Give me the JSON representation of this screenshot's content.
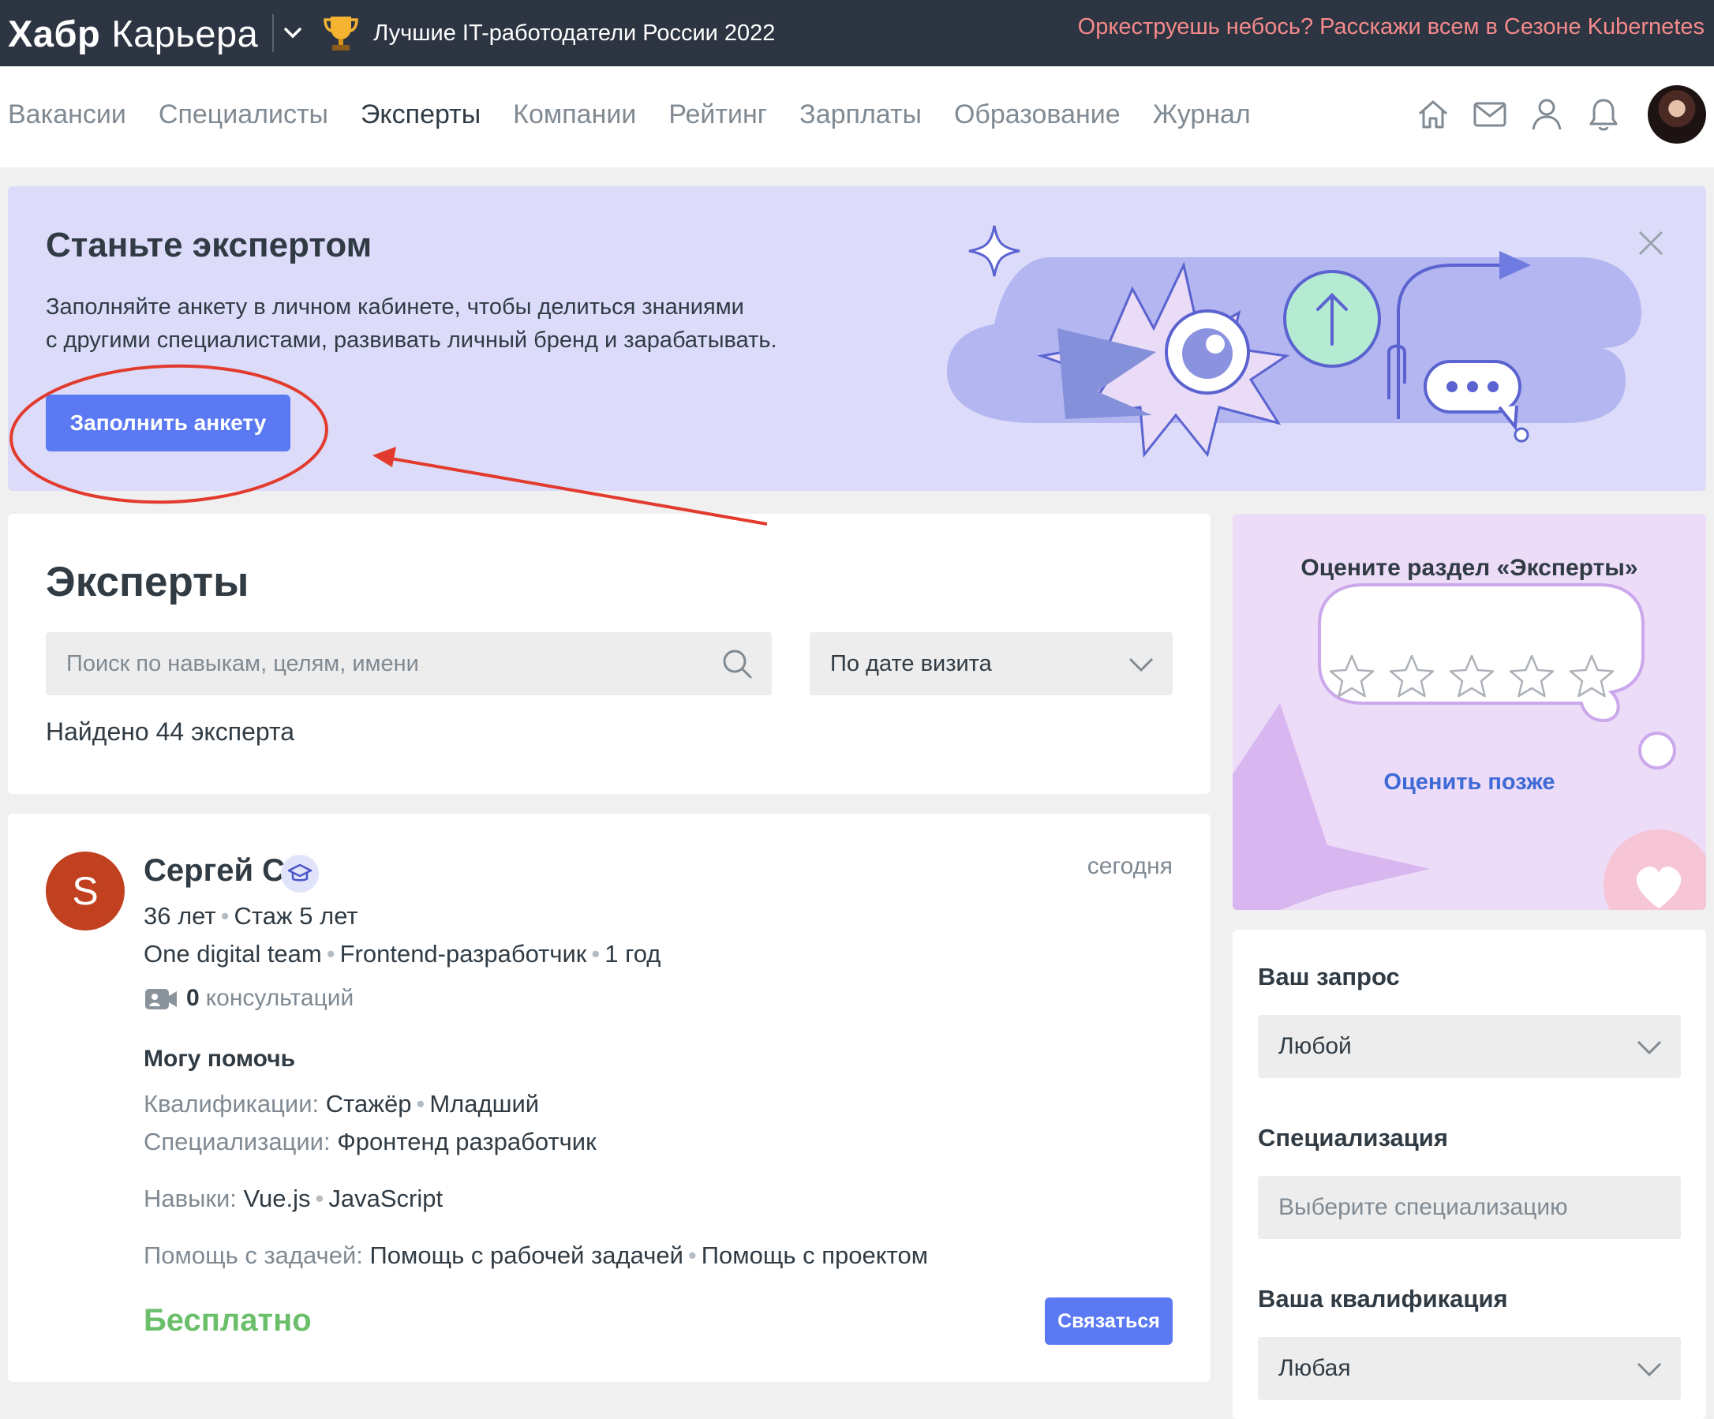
{
  "topbar": {
    "logo_bold": "Хабр",
    "logo_light": "Карьера",
    "promo_left": "Лучшие IT-работодатели России 2022",
    "promo_right": "Оркеструешь небось? Расскажи всем в Сезоне Kubernetes"
  },
  "nav": {
    "items": [
      "Вакансии",
      "Специалисты",
      "Эксперты",
      "Компании",
      "Рейтинг",
      "Зарплаты",
      "Образование",
      "Журнал"
    ],
    "active": "Эксперты",
    "icons": [
      "home-icon",
      "mail-icon",
      "user-icon",
      "bell-icon"
    ]
  },
  "banner": {
    "title": "Станьте экспертом",
    "text_line1": "Заполняйте анкету в личном кабинете, чтобы делиться знаниями",
    "text_line2": "с другими специалистами, развивать личный бренд и зарабатывать.",
    "button": "Заполнить анкету"
  },
  "experts": {
    "title": "Эксперты",
    "search_placeholder": "Поиск по навыкам, целям, имени",
    "sort_value": "По дате визита",
    "found": "Найдено 44 эксперта"
  },
  "expert": {
    "initial": "S",
    "name": "Сергей С",
    "date": "сегодня",
    "age": "36 лет",
    "experience": "Стаж 5 лет",
    "company": "One digital team",
    "role": "Frontend-разработчик",
    "duration": "1 год",
    "consult_count": "0",
    "consult_label": "консультаций",
    "can_help": "Могу помочь",
    "qual_label": "Квалификации:",
    "qual_1": "Стажёр",
    "qual_2": "Младший",
    "spec_label": "Специализации:",
    "spec_value": "Фронтенд разработчик",
    "skills_label": "Навыки:",
    "skill_1": "Vue.js",
    "skill_2": "JavaScript",
    "help_label": "Помощь с задачей:",
    "help_1": "Помощь с рабочей задачей",
    "help_2": "Помощь с проектом",
    "price": "Бесплатно",
    "contact": "Связаться"
  },
  "rating": {
    "title": "Оцените раздел «Эксперты»",
    "stars": 5,
    "later": "Оценить позже"
  },
  "filters": {
    "request_label": "Ваш запрос",
    "request_value": "Любой",
    "spec_label": "Специализация",
    "spec_placeholder": "Выберите специализацию",
    "qual_label": "Ваша квалификация",
    "qual_value": "Любая"
  },
  "colors": {
    "accent": "#5a79f3",
    "annotation": "#e23b2e",
    "price_green": "#6bbf6b",
    "topbar": "#2d3442",
    "banner_bg": "#dcdcfa"
  }
}
